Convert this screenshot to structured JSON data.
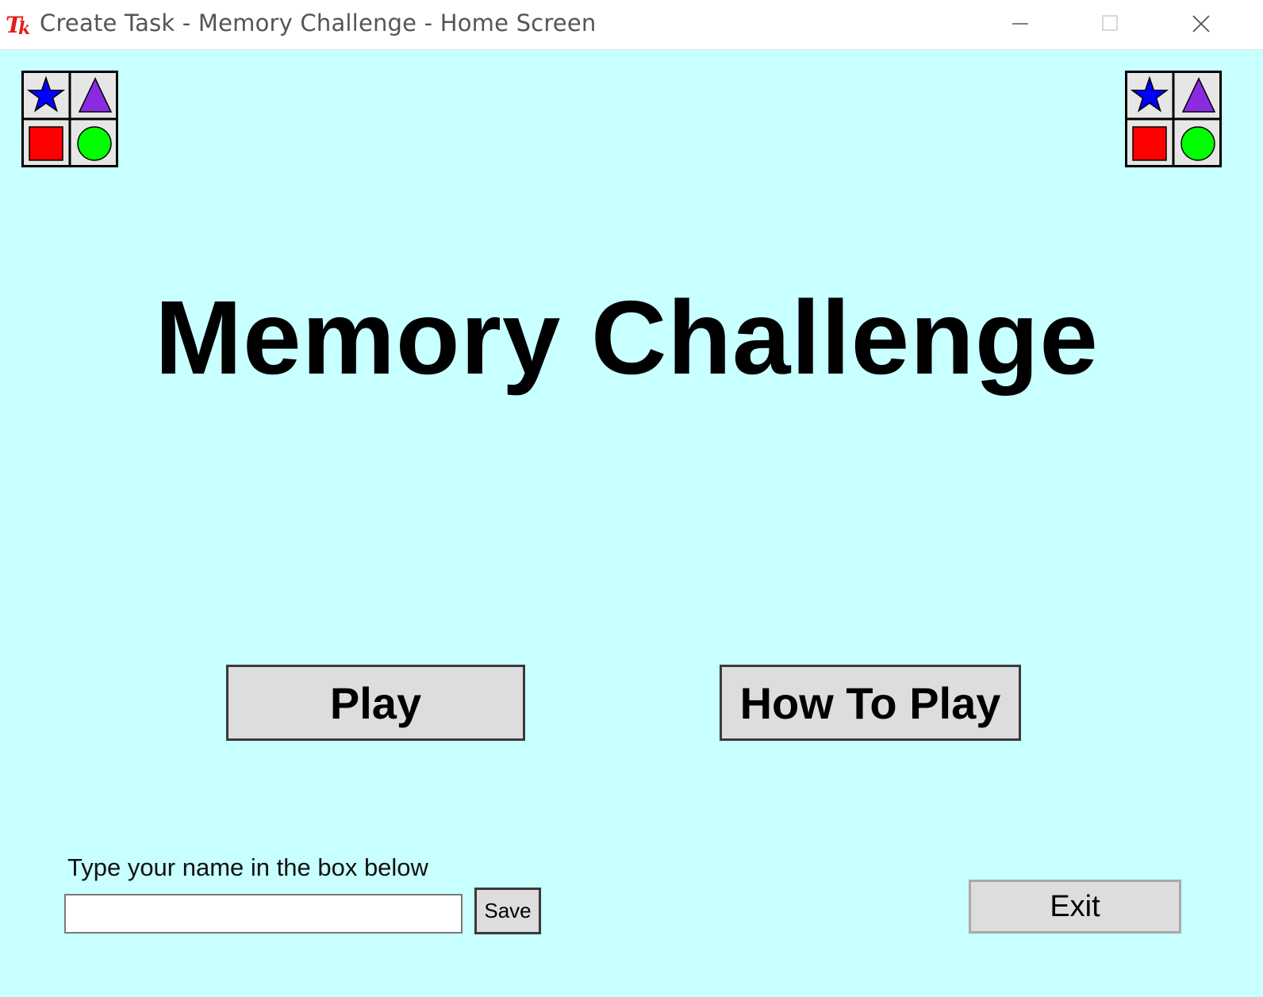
{
  "window": {
    "title": "Create Task - Memory Challenge - Home Screen",
    "icon": "tk-feather-icon",
    "controls": [
      "minimize-icon",
      "maximize-icon",
      "close-icon"
    ]
  },
  "decor": {
    "shapes": [
      "star-icon",
      "triangle-icon",
      "square-icon",
      "circle-icon"
    ],
    "colors": {
      "star": "#0000ff",
      "triangle": "#8a2be2",
      "square": "#ff0000",
      "circle": "#00ff00"
    }
  },
  "main": {
    "title": "Memory Challenge",
    "play_label": "Play",
    "how_to_play_label": "How To Play"
  },
  "name_entry": {
    "label": "Type your name in the box below",
    "value": "",
    "save_label": "Save"
  },
  "exit_label": "Exit",
  "colors": {
    "background": "#c8ffff",
    "button_face": "#dddddd"
  }
}
